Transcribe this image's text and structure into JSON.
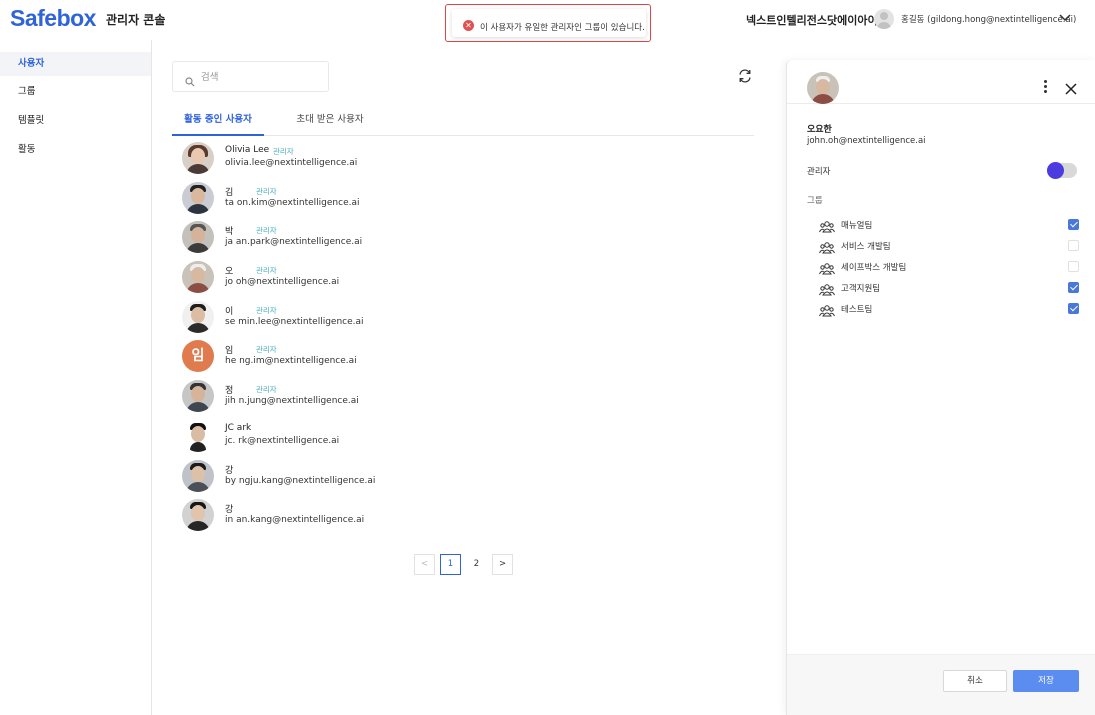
{
  "header": {
    "logo": "Safebox",
    "console_title": "관리자 콘솔",
    "org_name": "넥스트인텔리전스닷에이아이",
    "user_display": "홍길동 (gildong.hong@nextintelligence.ai)"
  },
  "toast": {
    "message": "이 사용자가 유일한 관리자인 그룹이 있습니다.",
    "type": "error",
    "color": "#e04545"
  },
  "sidebar": {
    "items": [
      {
        "label": "사용자",
        "active": true
      },
      {
        "label": "그룹",
        "active": false
      },
      {
        "label": "템플릿",
        "active": false
      },
      {
        "label": "활동",
        "active": false
      }
    ]
  },
  "search": {
    "placeholder": "검색",
    "value": ""
  },
  "tabs": [
    {
      "label": "활동 중인 사용자",
      "active": true
    },
    {
      "label": "초대 받은 사용자",
      "active": false
    }
  ],
  "users": [
    {
      "name": "Olivia Lee",
      "email": "olivia.lee@nextintelligence.ai",
      "badge": "관리자",
      "avatar": "photo"
    },
    {
      "name": "김",
      "email": "ta    on.kim@nextintelligence.ai",
      "badge": "관리자",
      "avatar": "photo"
    },
    {
      "name": "박",
      "email": "ja    an.park@nextintelligence.ai",
      "badge": "관리자",
      "avatar": "photo"
    },
    {
      "name": "오",
      "email": "jo    oh@nextintelligence.ai",
      "badge": "관리자",
      "avatar": "photo"
    },
    {
      "name": "이",
      "email": "se    min.lee@nextintelligence.ai",
      "badge": "관리자",
      "avatar": "photo"
    },
    {
      "name": "임",
      "email": "he    ng.im@nextintelligence.ai",
      "badge": "관리자",
      "avatar": "initial",
      "initial": "임"
    },
    {
      "name": "정",
      "email": "jih    n.jung@nextintelligence.ai",
      "badge": "관리자",
      "avatar": "photo"
    },
    {
      "name": "JC    ark",
      "email": "jc.    rk@nextintelligence.ai",
      "badge": "",
      "avatar": "photo"
    },
    {
      "name": "강",
      "email": "by    ngju.kang@nextintelligence.ai",
      "badge": "",
      "avatar": "photo"
    },
    {
      "name": "강",
      "email": "in    an.kang@nextintelligence.ai",
      "badge": "",
      "avatar": "photo"
    }
  ],
  "pagination": {
    "prev": "<",
    "pages": [
      "1",
      "2"
    ],
    "current": "1",
    "next": ">"
  },
  "panel": {
    "name": "오요한",
    "email": "john.oh@nextintelligence.ai",
    "admin_label": "관리자",
    "admin_enabled": true,
    "groups_label": "그룹",
    "groups": [
      {
        "name": "매뉴얼팀",
        "checked": true
      },
      {
        "name": "서비스 개발팀",
        "checked": false
      },
      {
        "name": "세이프박스 개발팀",
        "checked": false
      },
      {
        "name": "고객지원팀",
        "checked": true
      },
      {
        "name": "테스트팀",
        "checked": true
      }
    ],
    "cancel_label": "취소",
    "save_label": "저장"
  },
  "colors": {
    "brand": "#2f63d8",
    "accent_badge": "#4aaec0",
    "toggle_on": "#4b3be0",
    "save_button": "#5b8df0",
    "checkbox_on": "#4a78d8"
  }
}
